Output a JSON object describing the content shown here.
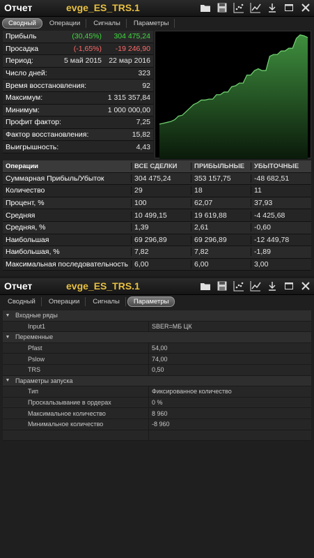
{
  "report": {
    "title": "Отчет",
    "strategy": "evge_ES_TRS.1"
  },
  "tabs": [
    "Сводный",
    "Операции",
    "Сигналы",
    "Параметры"
  ],
  "summary": [
    {
      "label": "Прибыль",
      "v1": "(30,45%)",
      "v2": "304 475,24",
      "color": "green"
    },
    {
      "label": "Просадка",
      "v1": "(-1,65%)",
      "v2": "-19 246,90",
      "color": "red"
    },
    {
      "label": "Период:",
      "v1": "5 май 2015",
      "v2": "22 мар 2016",
      "color": ""
    },
    {
      "label": "Число дней:",
      "value": "323"
    },
    {
      "label": "Время восстановления:",
      "value": "92"
    },
    {
      "label": "Максимум:",
      "value": "1 315 357,84"
    },
    {
      "label": "Минимум:",
      "value": "1 000 000,00"
    },
    {
      "label": "Профит фактор:",
      "value": "7,25"
    },
    {
      "label": "Фактор восстановления:",
      "value": "15,82"
    },
    {
      "label": "Выигрышность:",
      "value": "4,43"
    }
  ],
  "equity_curve": {
    "color": "#6fcf6f",
    "y": [
      0,
      0.01,
      0.02,
      0.03,
      0.05,
      0.09,
      0.1,
      0.14,
      0.18,
      0.22,
      0.24,
      0.27,
      0.27,
      0.28,
      0.28,
      0.33,
      0.33,
      0.36,
      0.36,
      0.42,
      0.43,
      0.46,
      0.46,
      0.55,
      0.55,
      0.6,
      0.62,
      0.6,
      0.6,
      0.76,
      0.78,
      0.78,
      0.82,
      0.82,
      0.85,
      0.85,
      0.96,
      1.0,
      0.99,
      0.97
    ]
  },
  "operations": {
    "headers": [
      "Операции",
      "ВСЕ СДЕЛКИ",
      "ПРИБЫЛЬНЫЕ",
      "УБЫТОЧНЫЕ"
    ],
    "rows": [
      [
        "Суммарная Прибыль/Убыток",
        "304 475,24",
        "353 157,75",
        "-48 682,51"
      ],
      [
        "Количество",
        "29",
        "18",
        "11"
      ],
      [
        "Процент, %",
        "100",
        "62,07",
        "37,93"
      ],
      [
        "Средняя",
        "10 499,15",
        "19 619,88",
        "-4 425,68"
      ],
      [
        "Средняя, %",
        "1,39",
        "2,61",
        "-0,60"
      ],
      [
        "Наибольшая",
        "69 296,89",
        "69 296,89",
        "-12 449,78"
      ],
      [
        "Наибольшая, %",
        "7,82",
        "7,82",
        "-1,89"
      ],
      [
        "Максимальная последовательность",
        "6,00",
        "6,00",
        "3,00"
      ]
    ]
  },
  "params": [
    {
      "group": "Входные ряды",
      "items": [
        {
          "name": "Input1",
          "value": "SBER=МБ ЦК"
        }
      ]
    },
    {
      "group": "Переменные",
      "items": [
        {
          "name": "Pfast",
          "value": "54,00"
        },
        {
          "name": "Pslow",
          "value": "74,00"
        },
        {
          "name": "TRS",
          "value": "0,50"
        }
      ]
    },
    {
      "group": "Параметры запуска",
      "items": [
        {
          "name": "Тип",
          "value": "Фиксированное количество"
        },
        {
          "name": "Проскальзывание в ордерах",
          "value": "0 %"
        },
        {
          "name": "Максимальное количество",
          "value": "8 960"
        },
        {
          "name": "Минимальное количество",
          "value": "-8 960"
        }
      ]
    }
  ]
}
